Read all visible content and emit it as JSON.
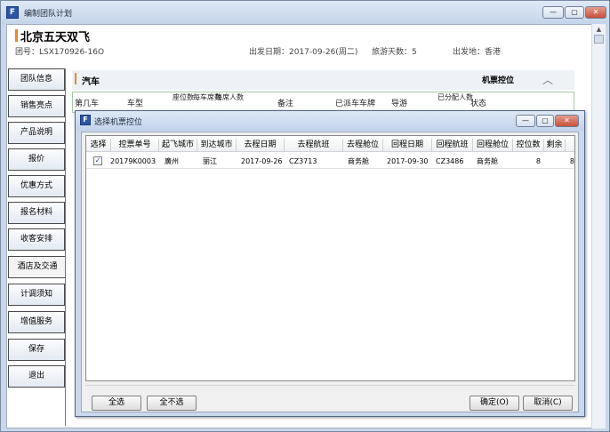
{
  "window": {
    "title": "编制团队计划",
    "icon_letter": "F",
    "buttons": {
      "minimize": "—",
      "maximize": "▢",
      "close": "✕"
    }
  },
  "header": {
    "title": "北京五天双飞",
    "group_no": "团号：LSX170926-16O",
    "depart_date": "出发日期：2017-09-26(周二)",
    "travel_days": "旅游天数：5",
    "depart_place": "出发地：香港"
  },
  "sidebar": {
    "items": [
      {
        "label": "团队信息"
      },
      {
        "label": "销售亮点"
      },
      {
        "label": "产品说明"
      },
      {
        "label": "报价"
      },
      {
        "label": "优惠方式"
      },
      {
        "label": "报名材料"
      },
      {
        "label": "收客安排"
      },
      {
        "label": "酒店及交通"
      },
      {
        "label": "计调须知"
      },
      {
        "label": "增值服务"
      },
      {
        "label": "保存"
      },
      {
        "label": "退出"
      }
    ],
    "active_index": 7
  },
  "section": {
    "title": "汽车",
    "right_title": "机票控位",
    "columns": [
      "第几车",
      "车型",
      "座位数",
      "每车席数",
      "每席人数",
      "备注",
      "已派车车牌",
      "导游",
      "已分配人数",
      "状态"
    ]
  },
  "dialog": {
    "title": "选择机票控位",
    "icon_letter": "F",
    "columns": [
      "选择",
      "控票单号",
      "起飞城市",
      "到达城市",
      "去程日期",
      "去程航班",
      "去程舱位",
      "回程日期",
      "回程航班",
      "回程舱位",
      "控位数",
      "剩余"
    ],
    "rows": [
      {
        "checked": "✓",
        "ticket_no": "20179K0003",
        "from_city": "廣州",
        "to_city": "丽江",
        "go_date": "2017-09-26",
        "go_flight": "CZ3713",
        "go_class": "商务舱",
        "back_date": "2017-09-30",
        "back_flight": "CZ3486",
        "back_class": "商务舱",
        "quota": "8",
        "remaining": "8"
      }
    ],
    "buttons": {
      "select_all": "全选",
      "deselect_all": "全不选",
      "ok": "确定(O)",
      "cancel": "取消(C)"
    }
  }
}
